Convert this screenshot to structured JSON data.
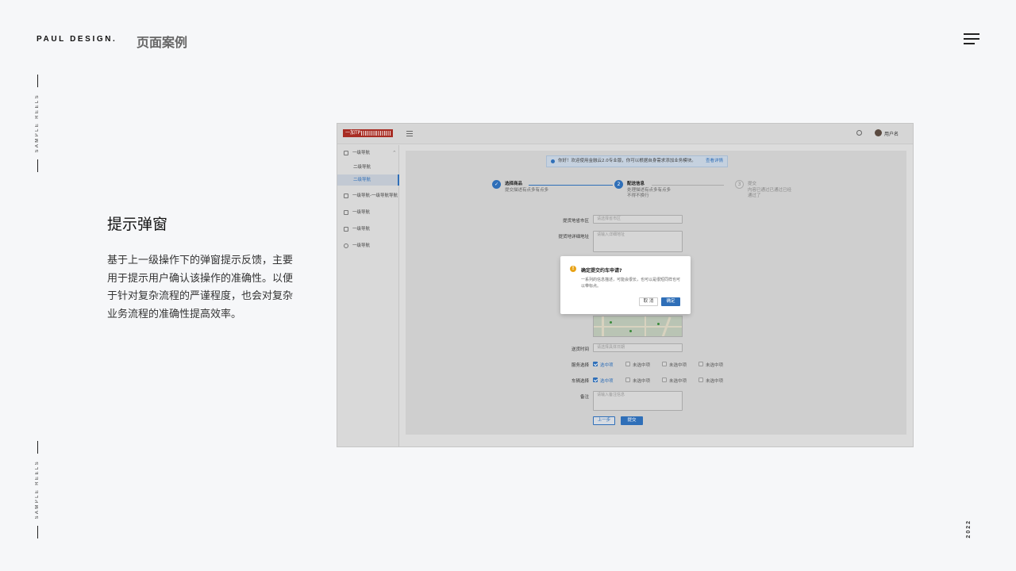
{
  "header": {
    "brand": "PAUL DESIGN.",
    "page_title": "页面案例"
  },
  "side": {
    "reel_text": "SAMPLE REELS",
    "year": "2022"
  },
  "section": {
    "title": "提示弹窗",
    "description": "基于上一级操作下的弹窗提示反馈，主要用于提示用户确认该操作的准确性。以便于针对复杂流程的严谨程度，也会对复杂业务流程的准确性提高效率。"
  },
  "mock": {
    "logo_text": "一加TP",
    "username": "用户名",
    "nav": {
      "item1": "一级导航",
      "sub1": "二级导航",
      "sub2": "二级导航",
      "item2": "一级导航-一级导航导航",
      "item3": "一级导航",
      "item4": "一级导航",
      "item5": "一级导航"
    },
    "alert": {
      "text": "你好！欢迎使用金融云2.0专业版，你可以根据自身需求添加业务模块。",
      "link": "查看详情"
    },
    "steps": [
      {
        "num": "✓",
        "title": "选择商品",
        "desc": "提交描述有点多有点多"
      },
      {
        "num": "2",
        "title": "配送信息",
        "desc": "处理描述有点多有点多",
        "desc2": "不得不换行"
      },
      {
        "num": "3",
        "title": "提交",
        "desc": "内容已通过已通过已经",
        "desc2": "通过了"
      }
    ],
    "form": {
      "province_label": "提货地省市区",
      "province_placeholder": "请选择省市区",
      "address_label": "提货地详细地址",
      "address_placeholder": "请输入详细地址",
      "time_label": "送货时间",
      "time_placeholder": "请选择具体日期",
      "service_label": "服务选择",
      "vehicle_label": "车辆选择",
      "option_checked": "选中项",
      "option_unchecked": "未选中项",
      "note_label": "备注",
      "note_placeholder": "请输入备注信息",
      "prev_button": "上一步",
      "submit_button": "提交"
    },
    "dialog": {
      "title": "确定提交约车申请?",
      "desc": "一系列的信息描述，可能会很长，也可以是很短同样也可以带标点。",
      "cancel": "取 消",
      "ok": "确定"
    }
  },
  "colors": {
    "accent": "#2f6fb8",
    "warning": "#e8a317",
    "logo_red": "#a82d24",
    "background": "#f6f7f9"
  },
  "icons": [
    "menu-icon",
    "collapse-icon",
    "search-icon",
    "home-icon",
    "edit-icon",
    "card-icon",
    "list-icon",
    "check-circle-icon",
    "warning-icon"
  ]
}
